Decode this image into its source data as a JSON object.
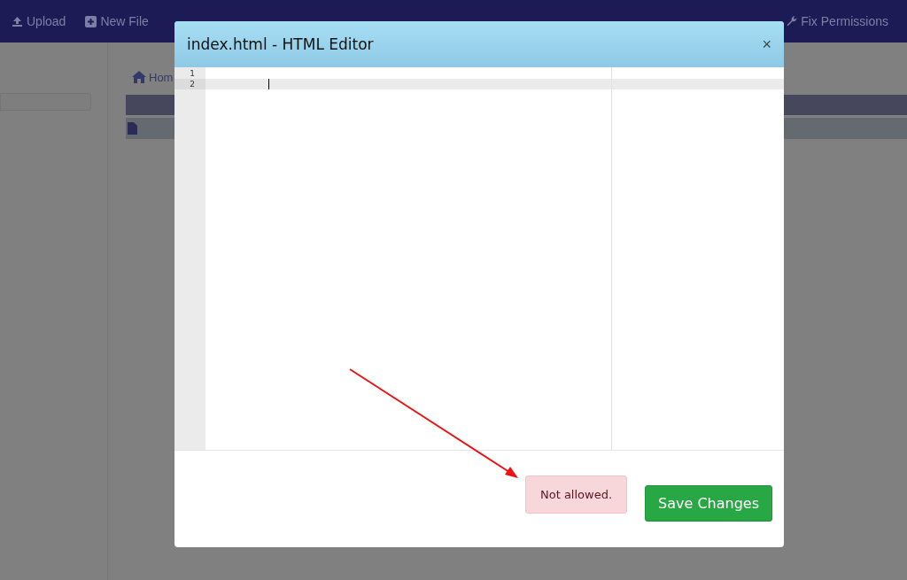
{
  "toolbar": [
    {
      "label": "Upload"
    },
    {
      "label": "New File"
    },
    {
      "label": "Fix Permissions"
    }
  ],
  "breadcrumb": "Hom",
  "modal": {
    "title": "index.html - HTML Editor",
    "close": "×",
    "editor": {
      "lines": [
        {
          "number": "1",
          "active": false
        },
        {
          "number": "2",
          "active": true
        }
      ]
    },
    "alert": "Not allowed.",
    "save_button": "Save Changes"
  }
}
